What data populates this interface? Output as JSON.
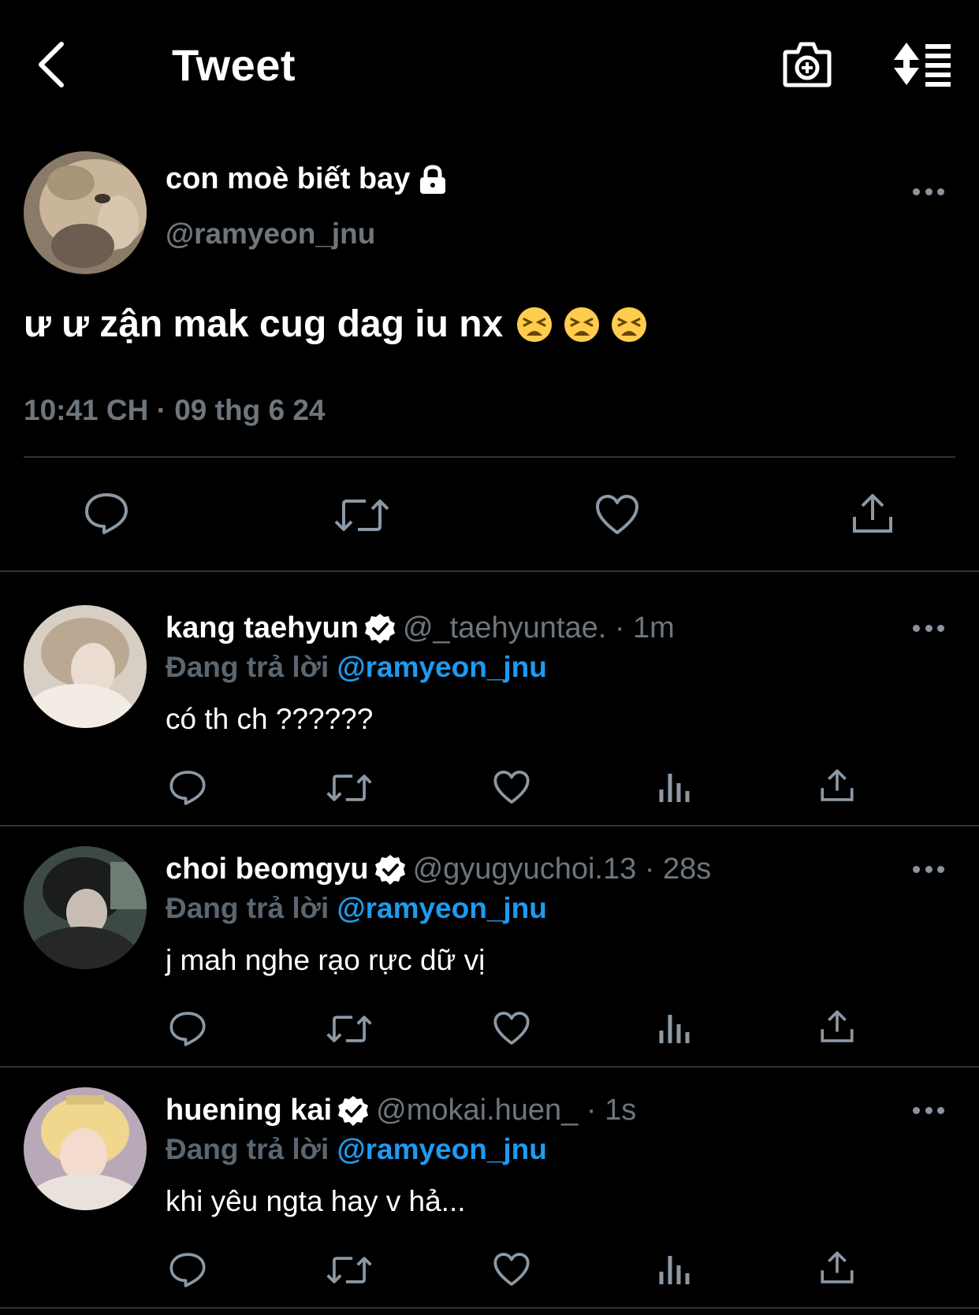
{
  "header": {
    "title": "Tweet",
    "back_icon": "chevron-left-icon",
    "camera_icon": "camera-add-icon",
    "sort_icon": "sort-list-icon"
  },
  "main_tweet": {
    "display_name": "con moè biết bay",
    "handle": "@ramyeon_jnu",
    "locked_icon": "lock-icon",
    "text": "ư ư zận mak cug dag iu nx",
    "emojis": [
      "weary-face",
      "weary-face",
      "weary-face"
    ],
    "timestamp": "10:41 CH · 09 thg 6 24"
  },
  "replies": [
    {
      "display_name": "kang taehyun",
      "handle_time": "@_taehyuntae. · 1m",
      "replying_label": "Đang trả lời",
      "mention": "@ramyeon_jnu",
      "text": "có th ch ??????"
    },
    {
      "display_name": "choi beomgyu",
      "handle_time": "@gyugyuchoi.13 · 28s",
      "replying_label": "Đang trả lời",
      "mention": "@ramyeon_jnu",
      "text": "j mah nghe rạo rực dữ vị"
    },
    {
      "display_name": "huening kai",
      "handle_time": "@mokai.huen_ · 1s",
      "replying_label": "Đang trả lời",
      "mention": "@ramyeon_jnu",
      "text": "khi yêu ngta hay v hả..."
    }
  ],
  "colors": {
    "background": "#000000",
    "text": "#ffffff",
    "muted": "#6e767d",
    "accent": "#1d9bf0",
    "divider": "#2f3336"
  }
}
